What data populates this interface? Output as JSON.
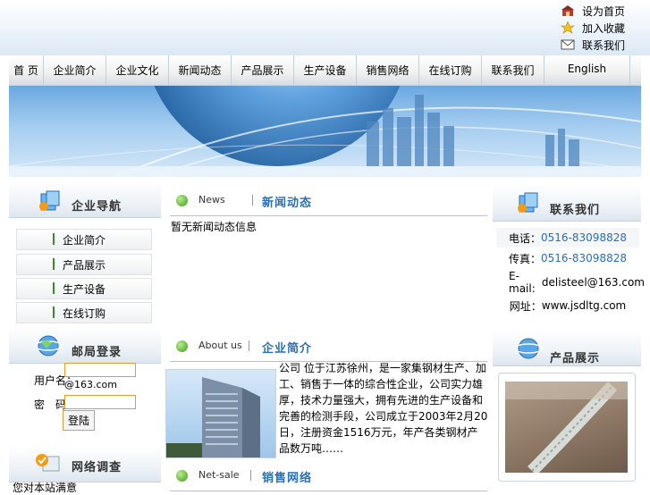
{
  "quick_links": [
    {
      "icon": "home-icon",
      "label": "设为首页"
    },
    {
      "icon": "star-icon",
      "label": "加入收藏"
    },
    {
      "icon": "mail-icon",
      "label": "联系我们"
    }
  ],
  "nav": [
    {
      "label": "首 页"
    },
    {
      "label": "企业简介"
    },
    {
      "label": "企业文化"
    },
    {
      "label": "新闻动态"
    },
    {
      "label": "产品展示"
    },
    {
      "label": "生产设备"
    },
    {
      "label": "销售网络"
    },
    {
      "label": "在线订购"
    },
    {
      "label": "联系我们"
    },
    {
      "label": "English"
    }
  ],
  "left": {
    "nav_title": "企业导航",
    "nav_items": [
      "企业简介",
      "产品展示",
      "生产设备",
      "在线订购"
    ],
    "mail_title": "邮局登录",
    "user_label": "用户名：",
    "user_suffix": "@163.com",
    "pass_label": "密　码：",
    "login_button": "登陆",
    "survey_title": "网络调查",
    "survey_text": "您对本站满意"
  },
  "middle": {
    "news": {
      "en": "News",
      "cn": "新闻动态",
      "text": "暂无新闻动态信息"
    },
    "about": {
      "en": "About us",
      "cn": "企业简介",
      "text": "公司 位于江苏徐州，是一家集钢材生产、加工、销售于一体的综合性企业，公司实力雄厚，技术力量强大，拥有先进的生产设备和完善的检测手段，公司成立于2003年2月20日，注册资金1516万元，年产各类钢材产品数万吨……"
    },
    "netsale": {
      "en": "Net-sale",
      "cn": "销售网络"
    }
  },
  "right": {
    "contact_title": "联系我们",
    "contacts": [
      {
        "label": "电话：",
        "value": "0516-83098828",
        "link": true
      },
      {
        "label": "传真：",
        "value": "0516-83098828",
        "link": true
      },
      {
        "label": "E-mail:",
        "value": "delisteel@163.com",
        "link": false
      },
      {
        "label": "网址：",
        "value": "www.jsdltg.com",
        "link": false
      }
    ],
    "products_title": "产品展示"
  },
  "colors": {
    "link": "#2a6fb5",
    "accent_green": "#3c9a1e",
    "input_border": "#e0a030"
  }
}
